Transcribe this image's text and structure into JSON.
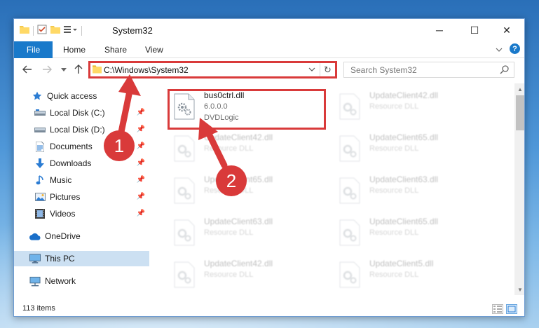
{
  "window": {
    "title": "System32",
    "controls": {
      "minimize": "─",
      "maximize": "☐",
      "close": "✕"
    }
  },
  "ribbon": {
    "tabs": [
      "File",
      "Home",
      "Share",
      "View"
    ],
    "help": "?"
  },
  "address": {
    "path": "C:\\Windows\\System32",
    "search_placeholder": "Search System32"
  },
  "sidebar": {
    "items": [
      {
        "label": "Quick access",
        "icon": "star-icon",
        "pinned": false
      },
      {
        "label": "Local Disk (C:)",
        "icon": "drive-icon",
        "pinned": true
      },
      {
        "label": "Local Disk (D:)",
        "icon": "drive-icon",
        "pinned": true
      },
      {
        "label": "Documents",
        "icon": "documents-icon",
        "pinned": true
      },
      {
        "label": "Downloads",
        "icon": "download-icon",
        "pinned": true
      },
      {
        "label": "Music",
        "icon": "music-icon",
        "pinned": true
      },
      {
        "label": "Pictures",
        "icon": "pictures-icon",
        "pinned": true
      },
      {
        "label": "Videos",
        "icon": "videos-icon",
        "pinned": true
      },
      {
        "label": "OneDrive",
        "icon": "cloud-icon",
        "pinned": false
      },
      {
        "label": "This PC",
        "icon": "computer-icon",
        "pinned": false,
        "selected": true
      },
      {
        "label": "Network",
        "icon": "network-icon",
        "pinned": false
      }
    ]
  },
  "files": [
    {
      "name": "bus0ctrl.dll",
      "line2": "6.0.0.0",
      "line3": "DVDLogic",
      "highlighted": true
    },
    {
      "name": "UpdateClient42.dll",
      "line2": "Resource DLL"
    },
    {
      "name": "UpdateClient42.dll",
      "line2": "Resource DLL"
    },
    {
      "name": "UpdateClient65.dll",
      "line2": "Resource DLL"
    },
    {
      "name": "UpdateClient65.dll",
      "line2": "Resource DLL"
    },
    {
      "name": "UpdateClient63.dll",
      "line2": "Resource DLL"
    },
    {
      "name": "UpdateClient63.dll",
      "line2": "Resource DLL"
    },
    {
      "name": "UpdateClient65.dll",
      "line2": "Resource DLL"
    },
    {
      "name": "UpdateClient42.dll",
      "line2": "Resource DLL"
    },
    {
      "name": "UpdateClient5.dll",
      "line2": "Resource DLL"
    }
  ],
  "status": {
    "count": "113 items"
  },
  "annotations": {
    "step1": "1",
    "step2": "2",
    "accent": "#d93a3a"
  }
}
